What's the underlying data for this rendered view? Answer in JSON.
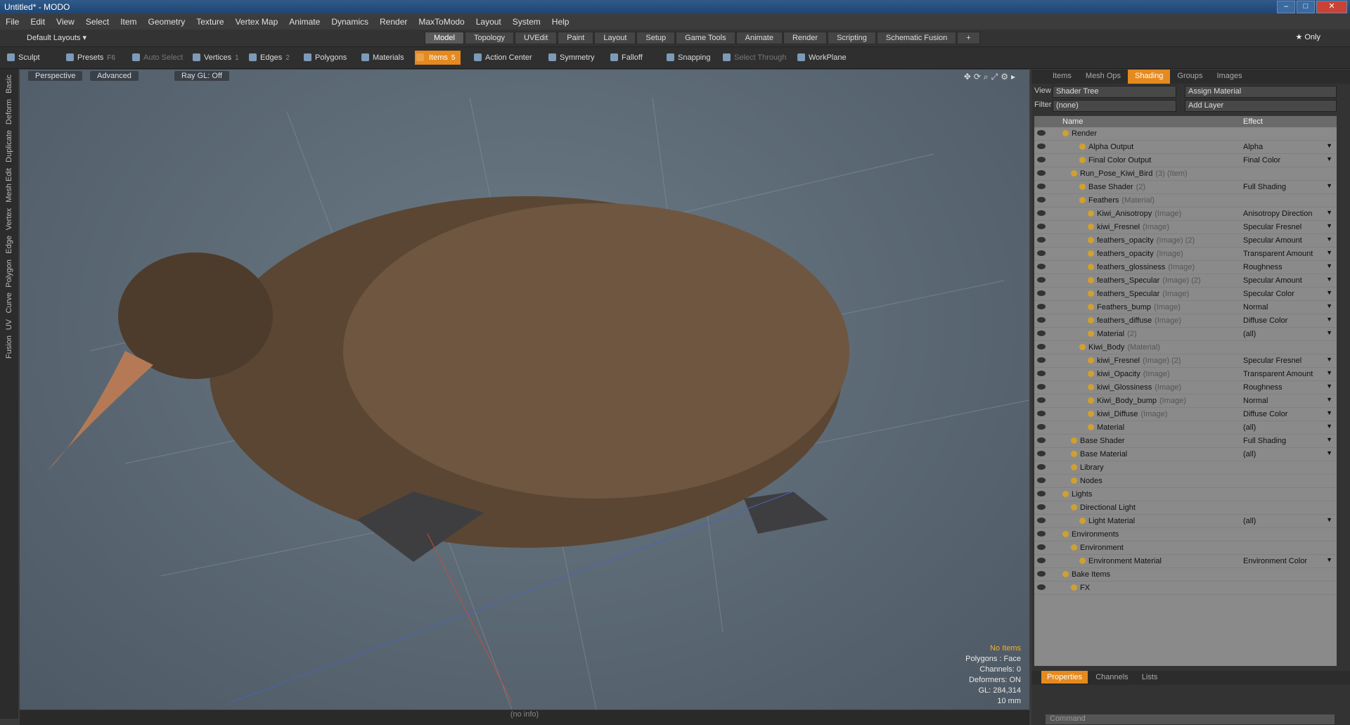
{
  "window": {
    "title": "Untitled* - MODO"
  },
  "menu": [
    "File",
    "Edit",
    "View",
    "Select",
    "Item",
    "Geometry",
    "Texture",
    "Vertex Map",
    "Animate",
    "Dynamics",
    "Render",
    "MaxToModo",
    "Layout",
    "System",
    "Help"
  ],
  "layouts": {
    "current": "Default Layouts ▾",
    "tabs": [
      "Model",
      "Topology",
      "UVEdit",
      "Paint",
      "Layout",
      "Setup",
      "Game Tools",
      "Animate",
      "Render",
      "Scripting",
      "Schematic Fusion"
    ],
    "active": "Model",
    "only": "★ Only"
  },
  "toolbar": {
    "sculpt": "Sculpt",
    "presets": "Presets",
    "presets_key": "F6",
    "auto_select": "Auto Select",
    "vertices": "Vertices",
    "vertices_key": "1",
    "edges": "Edges",
    "edges_key": "2",
    "polygons": "Polygons",
    "materials": "Materials",
    "items": "Items",
    "items_key": "5",
    "action_center": "Action Center",
    "symmetry": "Symmetry",
    "falloff": "Falloff",
    "snapping": "Snapping",
    "select_through": "Select Through",
    "workplane": "WorkPlane"
  },
  "sidetabs": [
    "Basic",
    "Deform",
    "Duplicate",
    "Mesh Edit",
    "Vertex",
    "Edge",
    "Polygon",
    "Curve",
    "UV",
    "Fusion"
  ],
  "viewport": {
    "view": "Perspective",
    "advanced": "Advanced",
    "raygl": "Ray GL: Off",
    "info": {
      "noitems": "No Items",
      "polygons": "Polygons : Face",
      "channels": "Channels: 0",
      "deformers": "Deformers: ON",
      "gl": "GL: 284,314",
      "scale": "10 mm"
    }
  },
  "status": "(no info)",
  "panel": {
    "tabs": [
      "Items",
      "Mesh Ops",
      "Shading",
      "Groups",
      "Images"
    ],
    "active": "Shading",
    "view_label": "View",
    "view_value": "Shader Tree",
    "assign": "Assign Material",
    "filter_label": "Filter",
    "filter_value": "(none)",
    "add_layer": "Add Layer",
    "col_name": "Name",
    "col_effect": "Effect",
    "rows": [
      {
        "name": "Render",
        "type": "",
        "effect": "",
        "indent": 0
      },
      {
        "name": "Alpha Output",
        "type": "",
        "effect": "Alpha",
        "indent": 2
      },
      {
        "name": "Final Color Output",
        "type": "",
        "effect": "Final Color",
        "indent": 2
      },
      {
        "name": "Run_Pose_Kiwi_Bird",
        "type": "(3) (Item)",
        "effect": "",
        "indent": 1
      },
      {
        "name": "Base Shader",
        "type": "(2)",
        "effect": "Full Shading",
        "indent": 2
      },
      {
        "name": "Feathers",
        "type": "(Material)",
        "effect": "",
        "indent": 2
      },
      {
        "name": "Kiwi_Anisotropy",
        "type": "(Image)",
        "effect": "Anisotropy Direction",
        "indent": 3
      },
      {
        "name": "kiwi_Fresnel",
        "type": "(Image)",
        "effect": "Specular Fresnel",
        "indent": 3
      },
      {
        "name": "feathers_opacity",
        "type": "(Image) (2)",
        "effect": "Specular Amount",
        "indent": 3
      },
      {
        "name": "feathers_opacity",
        "type": "(Image)",
        "effect": "Transparent Amount",
        "indent": 3
      },
      {
        "name": "feathers_glossiness",
        "type": "(Image)",
        "effect": "Roughness",
        "indent": 3
      },
      {
        "name": "feathers_Specular",
        "type": "(Image) (2)",
        "effect": "Specular Amount",
        "indent": 3
      },
      {
        "name": "feathers_Specular",
        "type": "(Image)",
        "effect": "Specular Color",
        "indent": 3
      },
      {
        "name": "Feathers_bump",
        "type": "(Image)",
        "effect": "Normal",
        "indent": 3
      },
      {
        "name": "feathers_diffuse",
        "type": "(Image)",
        "effect": "Diffuse Color",
        "indent": 3
      },
      {
        "name": "Material",
        "type": "(2)",
        "effect": "(all)",
        "indent": 3
      },
      {
        "name": "Kiwi_Body",
        "type": "(Material)",
        "effect": "",
        "indent": 2
      },
      {
        "name": "kiwi_Fresnel",
        "type": "(Image) (2)",
        "effect": "Specular Fresnel",
        "indent": 3
      },
      {
        "name": "kiwi_Opacity",
        "type": "(Image)",
        "effect": "Transparent Amount",
        "indent": 3
      },
      {
        "name": "kiwi_Glossiness",
        "type": "(Image)",
        "effect": "Roughness",
        "indent": 3
      },
      {
        "name": "Kiwi_Body_bump",
        "type": "(Image)",
        "effect": "Normal",
        "indent": 3
      },
      {
        "name": "kiwi_Diffuse",
        "type": "(Image)",
        "effect": "Diffuse Color",
        "indent": 3
      },
      {
        "name": "Material",
        "type": "",
        "effect": "(all)",
        "indent": 3
      },
      {
        "name": "Base Shader",
        "type": "",
        "effect": "Full Shading",
        "indent": 1
      },
      {
        "name": "Base Material",
        "type": "",
        "effect": "(all)",
        "indent": 1
      },
      {
        "name": "Library",
        "type": "",
        "effect": "",
        "indent": 1
      },
      {
        "name": "Nodes",
        "type": "",
        "effect": "",
        "indent": 1
      },
      {
        "name": "Lights",
        "type": "",
        "effect": "",
        "indent": 0
      },
      {
        "name": "Directional Light",
        "type": "",
        "effect": "",
        "indent": 1
      },
      {
        "name": "Light Material",
        "type": "",
        "effect": "(all)",
        "indent": 2
      },
      {
        "name": "Environments",
        "type": "",
        "effect": "",
        "indent": 0
      },
      {
        "name": "Environment",
        "type": "",
        "effect": "",
        "indent": 1
      },
      {
        "name": "Environment Material",
        "type": "",
        "effect": "Environment Color",
        "indent": 2
      },
      {
        "name": "Bake Items",
        "type": "",
        "effect": "",
        "indent": 0
      },
      {
        "name": "FX",
        "type": "",
        "effect": "",
        "indent": 1
      }
    ],
    "bottom_tabs": [
      "Properties",
      "Channels",
      "Lists"
    ],
    "bottom_active": "Properties",
    "command": "Command"
  }
}
